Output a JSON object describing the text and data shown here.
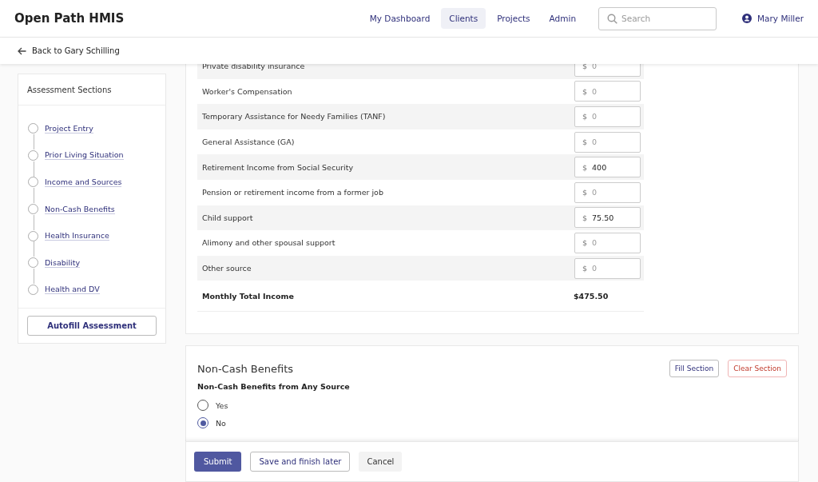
{
  "app": {
    "title": "Open Path HMIS"
  },
  "nav": [
    {
      "label": "My Dashboard",
      "selected": false
    },
    {
      "label": "Clients",
      "selected": true
    },
    {
      "label": "Projects",
      "selected": false
    },
    {
      "label": "Admin",
      "selected": false
    }
  ],
  "search": {
    "placeholder": "Search"
  },
  "user": {
    "name": "Mary Miller"
  },
  "back_link": "Back to Gary Schilling",
  "sidebar": {
    "title": "Assessment Sections",
    "items": [
      {
        "label": "Project Entry",
        "done": false
      },
      {
        "label": "Prior Living Situation",
        "done": false
      },
      {
        "label": "Income and Sources",
        "done": false
      },
      {
        "label": "Non-Cash Benefits",
        "done": false
      },
      {
        "label": "Health Insurance",
        "done": false
      },
      {
        "label": "Disability",
        "done": false
      },
      {
        "label": "Health and DV",
        "done": false
      }
    ],
    "button": "Autofill Assessment"
  },
  "income": {
    "rows": [
      {
        "label": "Private disability insurance",
        "currency": "$",
        "value": "",
        "placeholder": "0"
      },
      {
        "label": "Worker's Compensation",
        "currency": "$",
        "value": "",
        "placeholder": "0"
      },
      {
        "label": "Temporary Assistance for Needy Families (TANF)",
        "currency": "$",
        "value": "",
        "placeholder": "0"
      },
      {
        "label": "General Assistance (GA)",
        "currency": "$",
        "value": "",
        "placeholder": "0"
      },
      {
        "label": "Retirement Income from Social Security",
        "currency": "$",
        "value": "400"
      },
      {
        "label": "Pension or retirement income from a former job",
        "currency": "$",
        "value": "",
        "placeholder": "0"
      },
      {
        "label": "Child support",
        "currency": "$",
        "value": "75.50"
      },
      {
        "label": "Alimony and other spousal support",
        "currency": "$",
        "value": "",
        "placeholder": "0"
      },
      {
        "label": "Other source",
        "currency": "$",
        "value": "",
        "placeholder": "0"
      }
    ],
    "total_label": "Monthly Total Income",
    "total": "$475.50"
  },
  "non_cash": {
    "title": "Non-Cash Benefits",
    "fill_button": "Fill Section",
    "clear_button": "Clear Section",
    "question": "Non-Cash Benefits from Any Source",
    "options": [
      {
        "label": "Yes",
        "selected": false
      },
      {
        "label": "No",
        "selected": true
      }
    ]
  },
  "footer": {
    "submit": "Submit",
    "save": "Save and finish later",
    "cancel": "Cancel"
  }
}
